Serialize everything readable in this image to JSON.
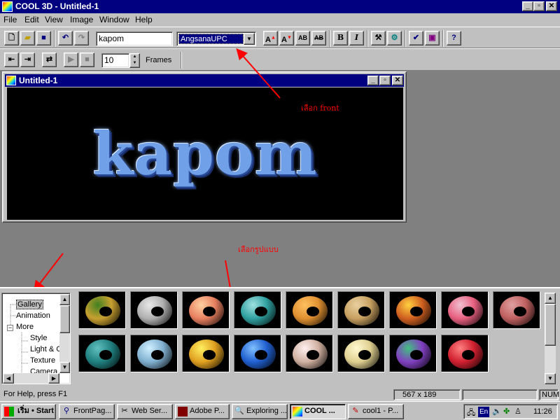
{
  "app": {
    "title": "COOL 3D - Untitled-1",
    "caption_buttons": {
      "minimize": "_",
      "restore": "▫",
      "close": "✕"
    }
  },
  "menu": [
    "File",
    "Edit",
    "View",
    "Image",
    "Window",
    "Help"
  ],
  "toolbar": {
    "text_value": "kapom",
    "font_value": "AngsanaUPC",
    "frames_value": "10",
    "frames_label": "Frames",
    "bold_label": "B",
    "italic_label": "I"
  },
  "document": {
    "title": "Untitled-1",
    "render_text": "kapom"
  },
  "annotations": {
    "font_note": "เลือก front",
    "style_note": "เลือกรูปแบบ"
  },
  "tree": {
    "items": [
      "Gallery",
      "Animation",
      "More",
      "Style",
      "Light & C",
      "Texture",
      "Camera"
    ],
    "expander": "−",
    "selected": "Gallery"
  },
  "thumbnails": {
    "row1": [
      {
        "color": "#c8a030",
        "accent": "#408020"
      },
      {
        "color": "#b0b0b0",
        "accent": "#e8e8e8"
      },
      {
        "color": "#e88060",
        "accent": "#ffd0a0"
      },
      {
        "color": "#30a0a0",
        "accent": "#a0e0e0"
      },
      {
        "color": "#e09030",
        "accent": "#ffc060"
      },
      {
        "color": "#c8a060",
        "accent": "#e8d0a0"
      },
      {
        "color": "#d06020",
        "accent": "#ffd040"
      },
      {
        "color": "#e86080",
        "accent": "#f0c0d0"
      },
      {
        "color": "#c06060",
        "accent": "#e0a0a0"
      }
    ],
    "row2": [
      {
        "color": "#208080",
        "accent": "#60c0c0"
      },
      {
        "color": "#80b0d0",
        "accent": "#d0f0ff"
      },
      {
        "color": "#e0a020",
        "accent": "#fff060"
      },
      {
        "color": "#2060d0",
        "accent": "#80c0ff"
      },
      {
        "color": "#d0b0a0",
        "accent": "#fff0f0"
      },
      {
        "color": "#e0d090",
        "accent": "#fff8d0"
      },
      {
        "color": "#8040c0",
        "accent": "#40c080"
      },
      {
        "color": "#d02030",
        "accent": "#ff8080"
      }
    ]
  },
  "status": {
    "help": "For Help, press F1",
    "dimensions": "567 x 189",
    "num": "NUM"
  },
  "taskbar": {
    "start": "เริ่ม • Start",
    "tasks": [
      "FrontPag...",
      "Web Ser...",
      "Adobe P...",
      "Exploring ...",
      "COOL ...",
      "cool1 - P..."
    ],
    "active": "COOL ...",
    "tray_lang": "En",
    "clock": "11:26"
  },
  "colors": {
    "titlebar": "#000080",
    "annotation": "#ff0000",
    "face": "#c0c0c0"
  }
}
